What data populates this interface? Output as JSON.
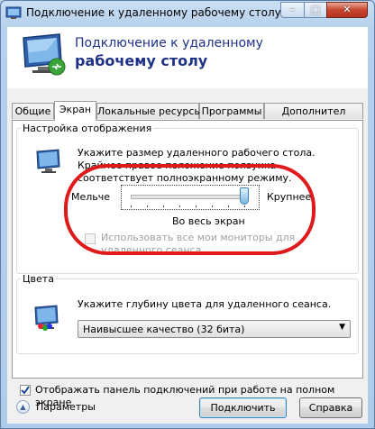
{
  "window": {
    "title": "Подключение к удаленному рабочему столу",
    "controls": {
      "minimize": "–",
      "maximize": "□",
      "close": "✕"
    }
  },
  "header": {
    "title_line1": "Подключение к удаленному",
    "title_line2": "рабочему столу"
  },
  "tabs": [
    {
      "label": "Общие"
    },
    {
      "label": "Экран"
    },
    {
      "label": "Локальные ресурсы"
    },
    {
      "label": "Программы"
    },
    {
      "label": "Дополнител"
    }
  ],
  "display": {
    "group_label": "Настройка отображения",
    "description": "Укажите размер удаленного рабочего стола. Крайнее правое положение ползунка соответствует полноэкранному режиму.",
    "slider": {
      "min_label": "Мельче",
      "max_label": "Крупнее",
      "value_label": "Во весь экран",
      "position_fraction": 1.0
    },
    "all_monitors": {
      "label": "Использовать все мои мониторы для удаленного сеанса",
      "checked": false,
      "enabled": false
    }
  },
  "colors": {
    "group_label": "Цвета",
    "description": "Укажите глубину цвета для удаленного сеанса.",
    "selected": "Наивысшее качество (32 бита)"
  },
  "bar_option": {
    "label": "Отображать панель подключений при работе на полном экране",
    "checked": true
  },
  "footer": {
    "params_label": "Параметры",
    "connect_label": "Подключить",
    "help_label": "Справка"
  },
  "annotation_color": "#e01a1a"
}
